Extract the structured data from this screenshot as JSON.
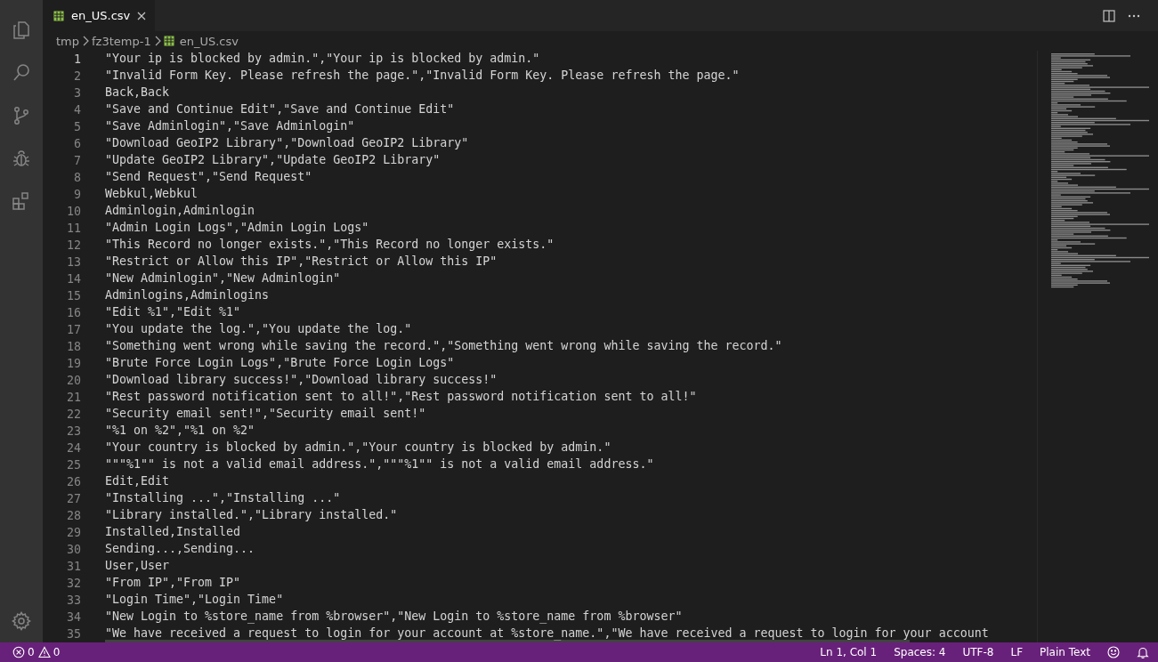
{
  "tabs": [
    {
      "label": "en_US.csv",
      "selected": true
    }
  ],
  "breadcrumbs": [
    {
      "label": "tmp",
      "kind": "folder"
    },
    {
      "label": "fz3temp-1",
      "kind": "folder"
    },
    {
      "label": "en_US.csv",
      "kind": "file"
    }
  ],
  "editor": {
    "lines": [
      {
        "number": "1",
        "text": "\"Your ip is blocked by admin.\",\"Your ip is blocked by admin.\"",
        "current": true
      },
      {
        "number": "2",
        "text": "\"Invalid Form Key. Please refresh the page.\",\"Invalid Form Key. Please refresh the page.\"",
        "current": false
      },
      {
        "number": "3",
        "text": "Back,Back",
        "current": false
      },
      {
        "number": "4",
        "text": "\"Save and Continue Edit\",\"Save and Continue Edit\"",
        "current": false
      },
      {
        "number": "5",
        "text": "\"Save Adminlogin\",\"Save Adminlogin\"",
        "current": false
      },
      {
        "number": "6",
        "text": "\"Download GeoIP2 Library\",\"Download GeoIP2 Library\"",
        "current": false
      },
      {
        "number": "7",
        "text": "\"Update GeoIP2 Library\",\"Update GeoIP2 Library\"",
        "current": false
      },
      {
        "number": "8",
        "text": "\"Send Request\",\"Send Request\"",
        "current": false
      },
      {
        "number": "9",
        "text": "Webkul,Webkul",
        "current": false
      },
      {
        "number": "10",
        "text": "Adminlogin,Adminlogin",
        "current": false
      },
      {
        "number": "11",
        "text": "\"Admin Login Logs\",\"Admin Login Logs\"",
        "current": false
      },
      {
        "number": "12",
        "text": "\"This Record no longer exists.\",\"This Record no longer exists.\"",
        "current": false
      },
      {
        "number": "13",
        "text": "\"Restrict or Allow this IP\",\"Restrict or Allow this IP\"",
        "current": false
      },
      {
        "number": "14",
        "text": "\"New Adminlogin\",\"New Adminlogin\"",
        "current": false
      },
      {
        "number": "15",
        "text": "Adminlogins,Adminlogins",
        "current": false
      },
      {
        "number": "16",
        "text": "\"Edit %1\",\"Edit %1\"",
        "current": false
      },
      {
        "number": "17",
        "text": "\"You update the log.\",\"You update the log.\"",
        "current": false
      },
      {
        "number": "18",
        "text": "\"Something went wrong while saving the record.\",\"Something went wrong while saving the record.\"",
        "current": false
      },
      {
        "number": "19",
        "text": "\"Brute Force Login Logs\",\"Brute Force Login Logs\"",
        "current": false
      },
      {
        "number": "20",
        "text": "\"Download library success!\",\"Download library success!\"",
        "current": false
      },
      {
        "number": "21",
        "text": "\"Rest password notification sent to all!\",\"Rest password notification sent to all!\"",
        "current": false
      },
      {
        "number": "22",
        "text": "\"Security email sent!\",\"Security email sent!\"",
        "current": false
      },
      {
        "number": "23",
        "text": "\"%1 on %2\",\"%1 on %2\"",
        "current": false
      },
      {
        "number": "24",
        "text": "\"Your country is blocked by admin.\",\"Your country is blocked by admin.\"",
        "current": false
      },
      {
        "number": "25",
        "text": "\"\"\"%1\"\" is not a valid email address.\",\"\"\"%1\"\" is not a valid email address.\"",
        "current": false
      },
      {
        "number": "26",
        "text": "Edit,Edit",
        "current": false
      },
      {
        "number": "27",
        "text": "\"Installing ...\",\"Installing ...\"",
        "current": false
      },
      {
        "number": "28",
        "text": "\"Library installed.\",\"Library installed.\"",
        "current": false
      },
      {
        "number": "29",
        "text": "Installed,Installed",
        "current": false
      },
      {
        "number": "30",
        "text": "Sending...,Sending...",
        "current": false
      },
      {
        "number": "31",
        "text": "User,User",
        "current": false
      },
      {
        "number": "32",
        "text": "\"From IP\",\"From IP\"",
        "current": false
      },
      {
        "number": "33",
        "text": "\"Login Time\",\"Login Time\"",
        "current": false
      },
      {
        "number": "34",
        "text": "\"New Login to %store_name from %browser\",\"New Login to %store_name from %browser\"",
        "current": false
      },
      {
        "number": "35",
        "text": "\"We have received a request to login for your account at %store_name.\",\"We have received a request to login for your account",
        "current": false
      }
    ]
  },
  "status_bar": {
    "errors": "0",
    "warnings": "0",
    "items": [
      "Ln 1, Col 1",
      "Spaces: 4",
      "UTF-8",
      "LF",
      "Plain Text"
    ]
  }
}
